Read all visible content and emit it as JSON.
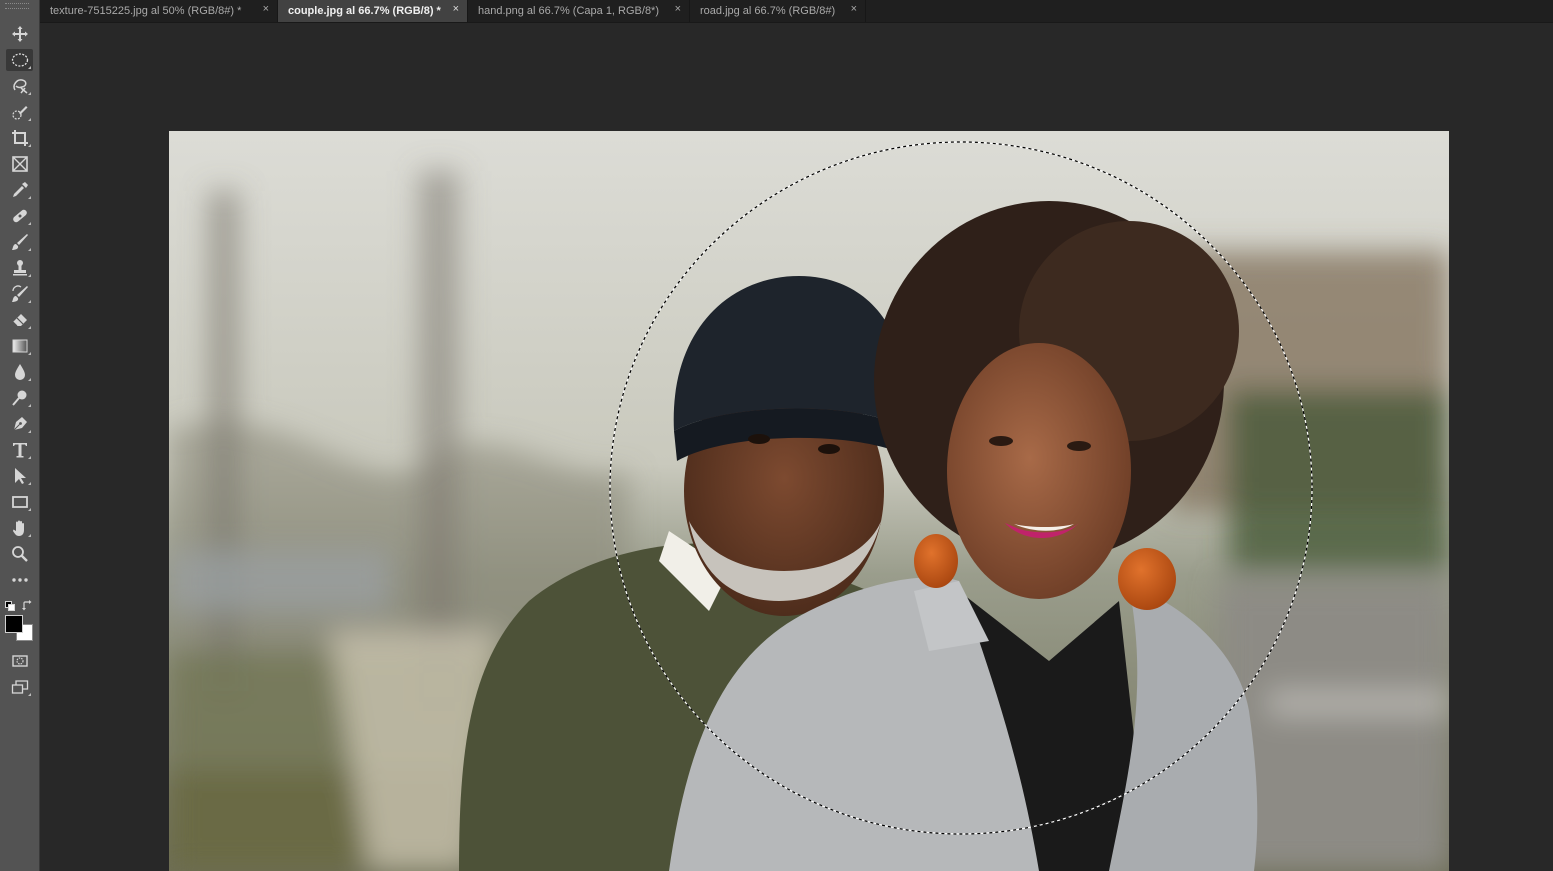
{
  "app": "Adobe Photoshop",
  "tabs": [
    {
      "label": "texture-7515225.jpg al 50% (RGB/8#) *",
      "close": "×",
      "active": false
    },
    {
      "label": "couple.jpg al 66.7% (RGB/8) *",
      "close": "×",
      "active": true
    },
    {
      "label": "hand.png al 66.7% (Capa 1, RGB/8*)",
      "close": "×",
      "active": false
    },
    {
      "label": "road.jpg al 66.7% (RGB/8#)",
      "close": "×",
      "active": false
    }
  ],
  "tools": [
    {
      "name": "move-tool-icon"
    },
    {
      "name": "elliptical-marquee-tool-icon",
      "active": true
    },
    {
      "name": "lasso-tool-icon"
    },
    {
      "name": "quick-selection-tool-icon"
    },
    {
      "name": "crop-tool-icon"
    },
    {
      "name": "frame-tool-icon"
    },
    {
      "name": "eyedropper-tool-icon"
    },
    {
      "name": "healing-brush-tool-icon"
    },
    {
      "name": "brush-tool-icon"
    },
    {
      "name": "clone-stamp-tool-icon"
    },
    {
      "name": "history-brush-tool-icon"
    },
    {
      "name": "eraser-tool-icon"
    },
    {
      "name": "gradient-tool-icon"
    },
    {
      "name": "blur-tool-icon"
    },
    {
      "name": "dodge-tool-icon"
    },
    {
      "name": "pen-tool-icon"
    },
    {
      "name": "type-tool-icon"
    },
    {
      "name": "path-selection-tool-icon"
    },
    {
      "name": "rectangle-tool-icon"
    },
    {
      "name": "hand-tool-icon"
    },
    {
      "name": "zoom-tool-icon"
    },
    {
      "name": "edit-toolbar-icon"
    }
  ],
  "colors": {
    "foreground": "#000000",
    "background": "#ffffff"
  },
  "canvas": {
    "document": "couple.jpg",
    "selection": "elliptical"
  }
}
